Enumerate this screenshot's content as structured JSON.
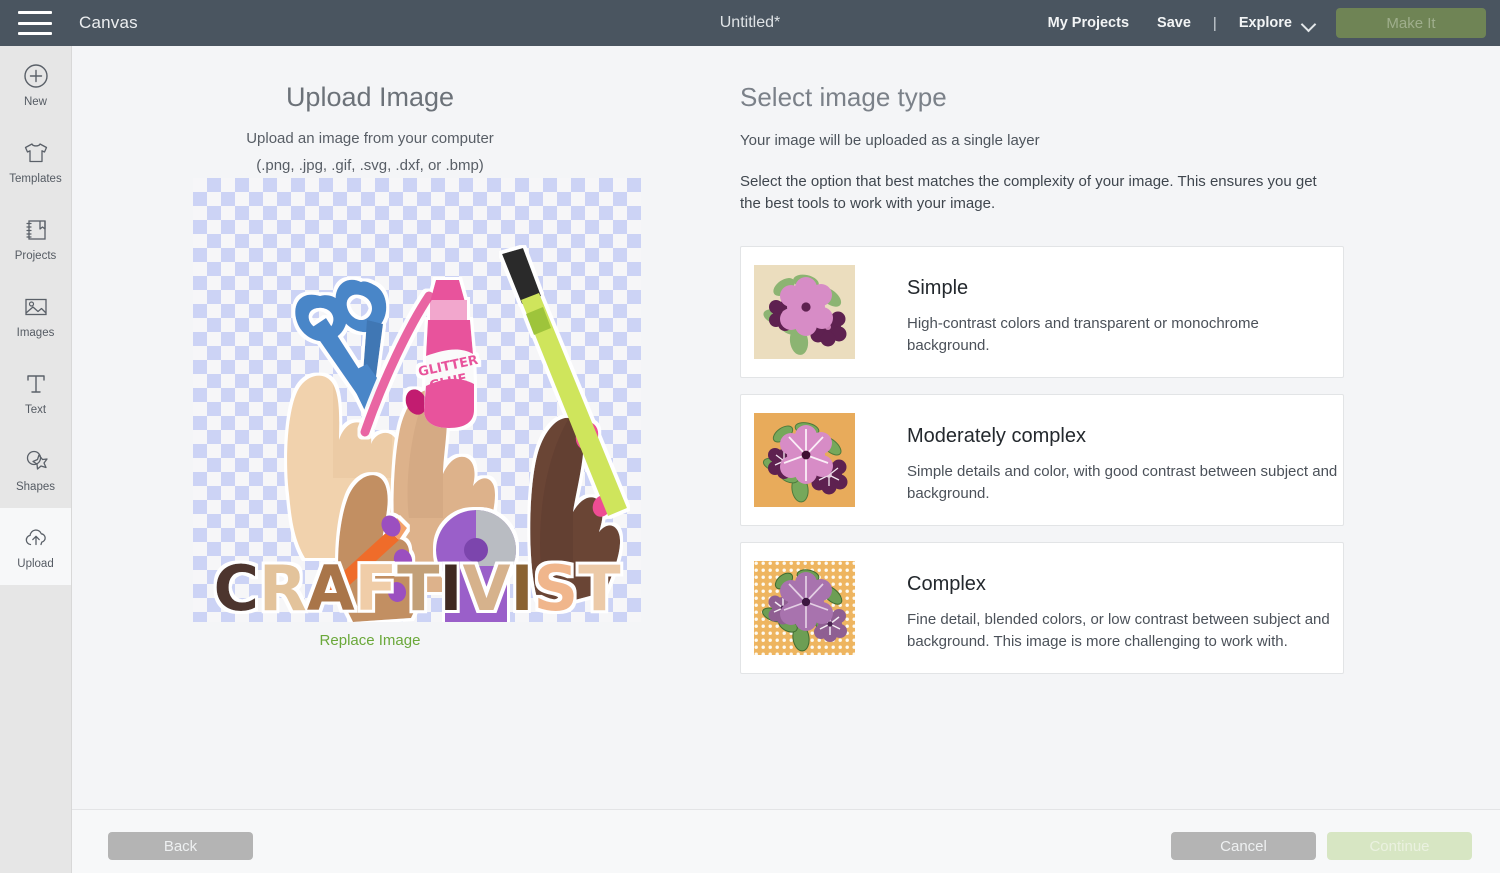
{
  "topbar": {
    "menu_icon": "hamburger-icon",
    "canvas_label": "Canvas",
    "project_title": "Untitled*",
    "my_projects": "My Projects",
    "save": "Save",
    "separator": "|",
    "explore": "Explore",
    "explore_chevron": "chevron-down-icon",
    "make_it": "Make It",
    "bg_color": "#4a5560",
    "make_it_color": "#6f8455"
  },
  "sidebar": {
    "items": [
      {
        "label": "New",
        "icon": "plus-circle-icon",
        "active": false
      },
      {
        "label": "Templates",
        "icon": "tshirt-icon",
        "active": false
      },
      {
        "label": "Projects",
        "icon": "notebook-icon",
        "active": false
      },
      {
        "label": "Images",
        "icon": "image-icon",
        "active": false
      },
      {
        "label": "Text",
        "icon": "text-t-icon",
        "active": false
      },
      {
        "label": "Shapes",
        "icon": "shapes-star-icon",
        "active": false
      },
      {
        "label": "Upload",
        "icon": "upload-cloud-icon",
        "active": true
      }
    ]
  },
  "upload_panel": {
    "title": "Upload Image",
    "subtitle_line1": "Upload an image from your computer",
    "subtitle_line2": "(.png, .jpg, .gif, .svg, .dxf, or .bmp)",
    "replace_link": "Replace Image",
    "replace_link_color": "#6aa83a",
    "preview": {
      "alt": "Illustration of four raised hands holding craft supplies above the word CRAFTIVIST",
      "transparency_checker_colors": [
        "#ccd3f5",
        "#f6f6f8"
      ],
      "word": "CRAFTIVIST",
      "word_letter_colors": [
        "#4e342e",
        "#e0c29c",
        "#a9754a",
        "#efc9a4",
        "#c8a780",
        "#3f2a24",
        "#d9b58c",
        "#8a6230",
        "#f0b68c",
        "#eccaa8"
      ],
      "supplies": [
        "scissors",
        "glitter glue",
        "paintbrush",
        "marker",
        "colored pencil"
      ],
      "glitter_label": "GLITTER GLUE"
    }
  },
  "type_panel": {
    "title": "Select image type",
    "subtitle": "Your image will be uploaded as a single layer",
    "description": "Select the option that best matches the complexity of your image. This ensures you get the best tools to work with your image.",
    "options": [
      {
        "name": "Simple",
        "description": "High-contrast colors and transparent or monochrome background.",
        "thumb_bg": "#ebddbe",
        "thumb_style": "flat"
      },
      {
        "name": "Moderately complex",
        "description": "Simple details and color, with good contrast between subject and background.",
        "thumb_bg": "#e8ab5b",
        "thumb_style": "detailed"
      },
      {
        "name": "Complex",
        "description": "Fine detail, blended colors, or low contrast between subject and background. This image is more challenging to work with.",
        "thumb_bg": "#eeb560",
        "thumb_style": "dotted"
      }
    ]
  },
  "footer": {
    "back": "Back",
    "cancel": "Cancel",
    "continue": "Continue"
  }
}
